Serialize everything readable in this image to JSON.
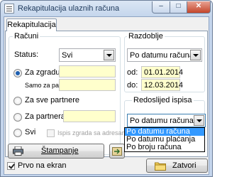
{
  "window": {
    "title": "Rekapitulacija ulaznih računa",
    "minimize_glyph": "–",
    "maximize_glyph": "□",
    "close_glyph": "✕"
  },
  "tab": {
    "label": "Rekapitulacija"
  },
  "racuni": {
    "legend": "Računi",
    "status_label": "Status:",
    "status_value": "Svi",
    "za_zgradu_label": "Za zgradu",
    "za_zgradu_value": "",
    "samo_za_patnera_label": "Samo za patnera:",
    "samo_za_patnera_value": "",
    "za_sve_partnere_label": "Za sve partnere",
    "za_partnera_label": "Za partnera",
    "za_partnera_value": "",
    "svi_label": "Svi",
    "ispis_zgrada_label": "Ispis zgrada sa adresama",
    "selected_radio": "Za zgradu"
  },
  "razdoblje": {
    "legend": "Razdoblje",
    "period_type_value": "Po datumu računa",
    "od_label": "od:",
    "od_value": "01.01.2014",
    "do_label": "do:",
    "do_value": "12.03.2014"
  },
  "redoslijed": {
    "legend": "Redoslijed ispisa",
    "selected_value": "Po datumu računa",
    "options": [
      "Po datumu računa",
      "Po datumu plaćanja",
      "Po broju računa"
    ],
    "highlighted_index": 0
  },
  "footer": {
    "stampanje_label": "Štampanje",
    "prvo_na_ekran_label": "Prvo na ekran",
    "prvo_na_ekran_checked": true,
    "zatvori_label": "Zatvori"
  }
}
